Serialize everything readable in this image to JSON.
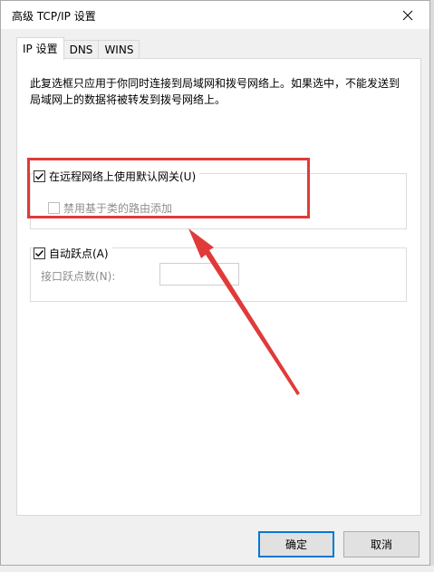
{
  "window": {
    "title": "高级 TCP/IP 设置"
  },
  "tabs": [
    {
      "label": "IP 设置",
      "active": true
    },
    {
      "label": "DNS",
      "active": false
    },
    {
      "label": "WINS",
      "active": false
    }
  ],
  "panel": {
    "description": "此复选框只应用于你同时连接到局域网和拨号网络上。如果选中，不能发送到局域网上的数据将被转发到拨号网络上。",
    "gateway_group": {
      "use_default_gateway": {
        "label": "在远程网络上使用默认网关(U)",
        "checked": true
      },
      "disable_class_route": {
        "label": "禁用基于类的路由添加",
        "checked": false,
        "disabled": true
      }
    },
    "metric_group": {
      "automatic_metric": {
        "label": "自动跃点(A)",
        "checked": true
      },
      "interface_metric_label": "接口跃点数(N):",
      "interface_metric_value": ""
    }
  },
  "buttons": {
    "ok": "确定",
    "cancel": "取消"
  },
  "annotation": {
    "color": "#e03a3a"
  }
}
